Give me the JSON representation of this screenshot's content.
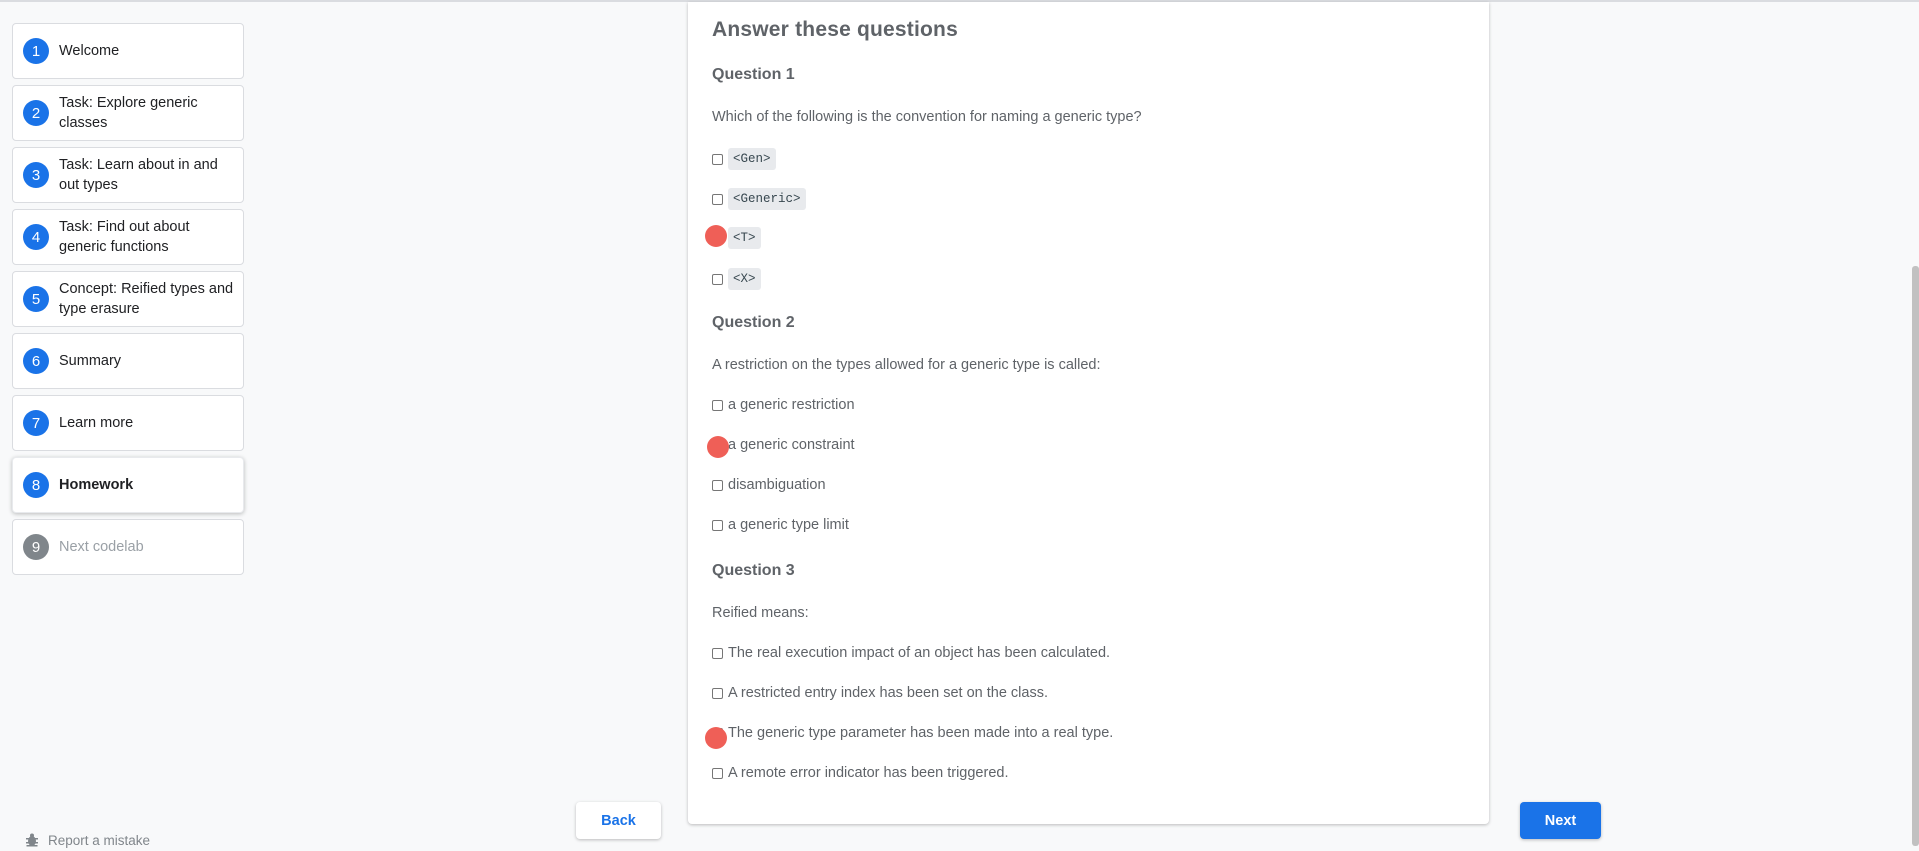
{
  "steps": [
    {
      "num": "1",
      "label": "Welcome"
    },
    {
      "num": "2",
      "label": "Task: Explore generic classes"
    },
    {
      "num": "3",
      "label": "Task: Learn about in and out types"
    },
    {
      "num": "4",
      "label": "Task: Find out about generic functions"
    },
    {
      "num": "5",
      "label": "Concept: Reified types and type erasure"
    },
    {
      "num": "6",
      "label": "Summary"
    },
    {
      "num": "7",
      "label": "Learn more"
    },
    {
      "num": "8",
      "label": "Homework"
    },
    {
      "num": "9",
      "label": "Next codelab"
    }
  ],
  "report": {
    "label": "Report a mistake",
    "icon": "bug-icon"
  },
  "main": {
    "heading": "Answer these questions",
    "questions": [
      {
        "title": "Question 1",
        "text": "Which of the following is the convention for naming a generic type?",
        "options": [
          "<Gen>",
          "<Generic>",
          "<T>",
          "<X>"
        ]
      },
      {
        "title": "Question 2",
        "text": "A restriction on the types allowed for a generic type is called:",
        "options": [
          "a generic restriction",
          "a generic constraint",
          "disambiguation",
          "a generic type limit"
        ]
      },
      {
        "title": "Question 3",
        "text": "Reified means:",
        "options": [
          "The real execution impact of an object has been calculated.",
          "A restricted entry index has been set on the class.",
          "The generic type parameter has been made into a real type.",
          "A remote error indicator has been triggered."
        ]
      }
    ]
  },
  "nav": {
    "back_label": "Back",
    "next_label": "Next"
  },
  "colors": {
    "accent": "#1a73e8",
    "marker": "#ef5f57",
    "disabled": "#80868b"
  }
}
